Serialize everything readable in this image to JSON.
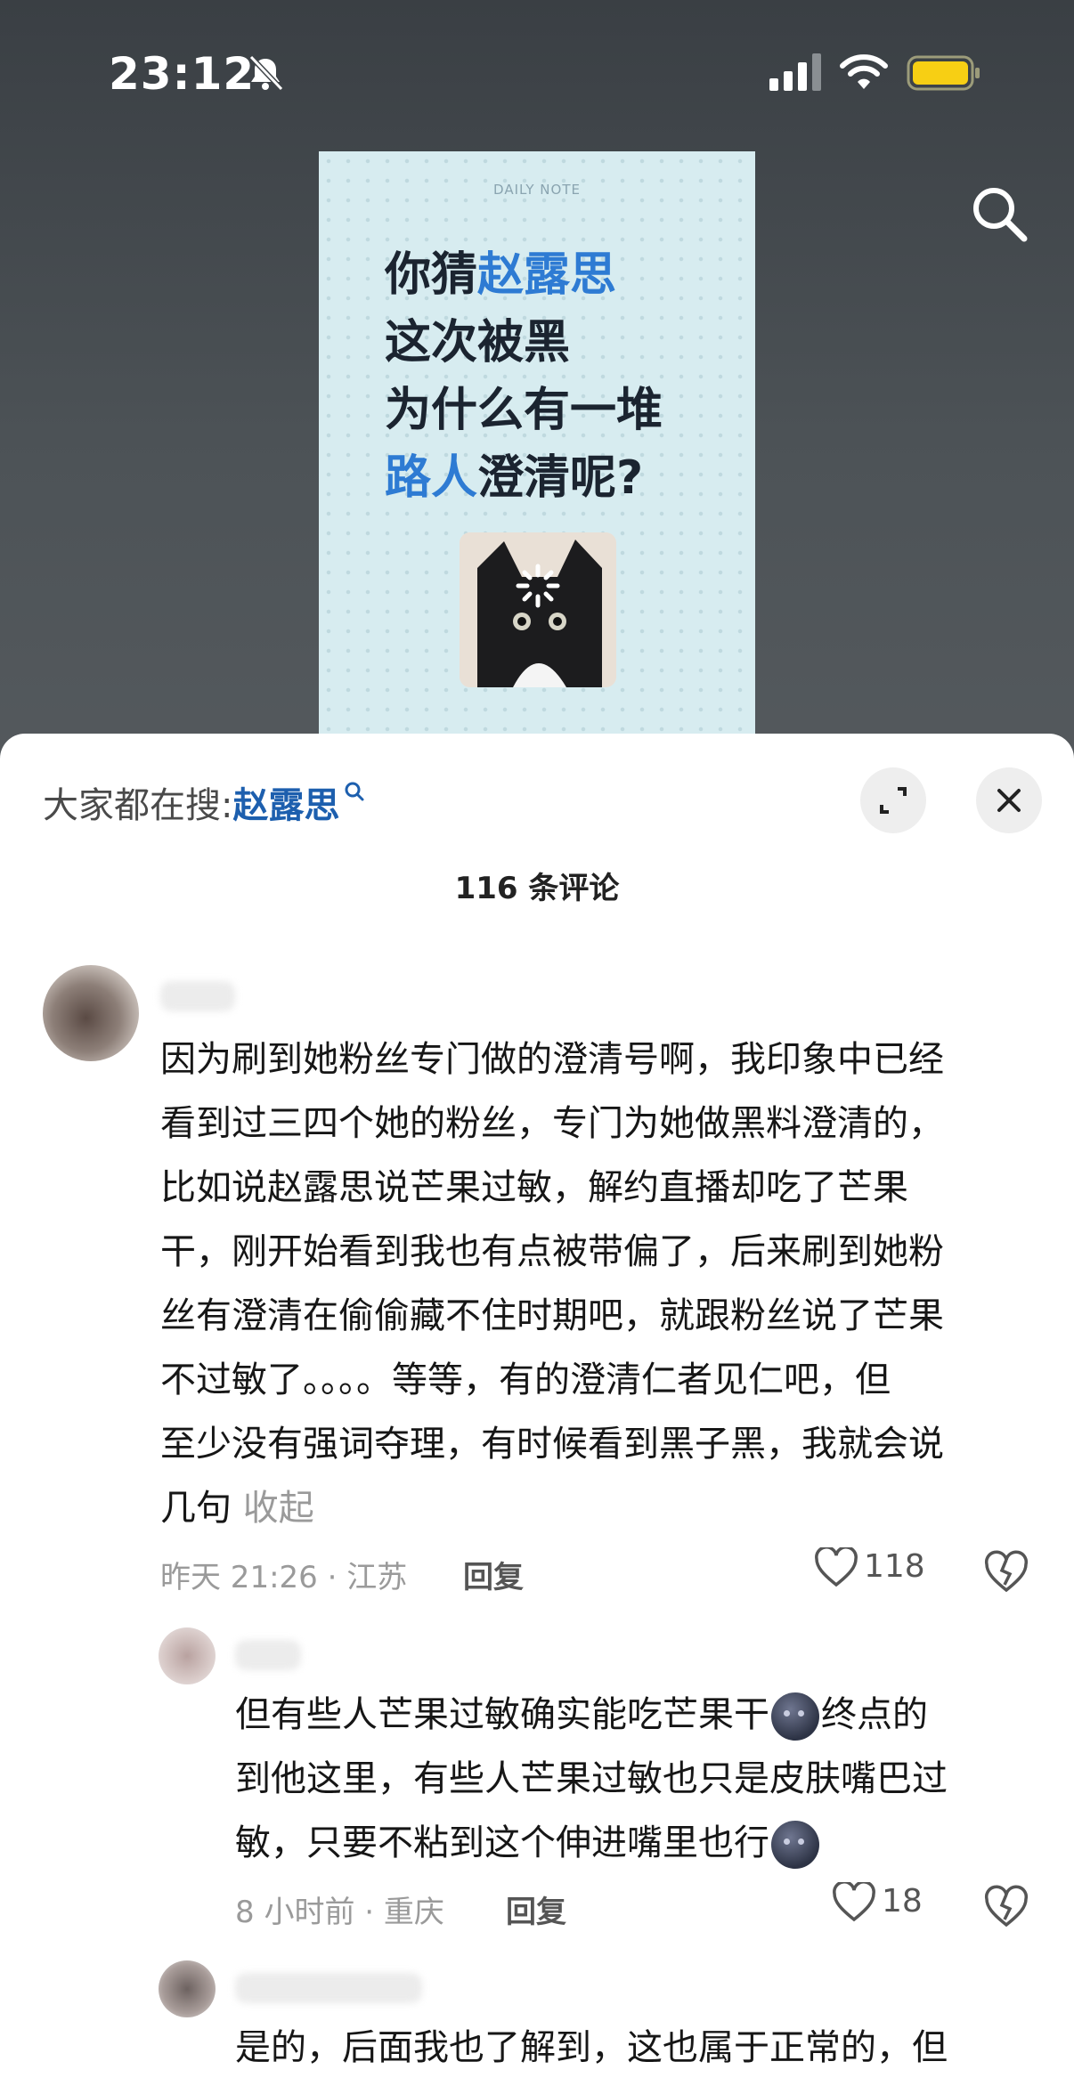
{
  "status_bar": {
    "time": "23:12"
  },
  "post": {
    "card_header": "DAILY NOTE",
    "title_lines": [
      {
        "pre": "你猜",
        "hl": "赵露思",
        "post": ""
      },
      {
        "pre": "这次被黑",
        "hl": "",
        "post": ""
      },
      {
        "pre": "为什么有一堆",
        "hl": "",
        "post": ""
      },
      {
        "pre": "",
        "hl": "路人",
        "post": "澄清呢?"
      }
    ]
  },
  "sheet": {
    "hot_search_label": "大家都在搜:",
    "hot_search_keyword": "赵露思",
    "comment_count": "116 条评论"
  },
  "comments": [
    {
      "lines": [
        "因为刷到她粉丝专门做的澄清号啊，我印象中已经",
        "看到过三四个她的粉丝，专门为她做黑料澄清的，",
        "比如说赵露思说芒果过敏，解约直播却吃了芒果",
        "干，刚开始看到我也有点被带偏了，后来刷到她粉",
        "丝有澄清在偷偷藏不住时期吧，就跟粉丝说了芒果",
        "不过敏了。。。。等等，有的澄清仁者见仁吧，但",
        "至少没有强词夺理，有时候看到黑子黑，我就会说"
      ],
      "last_line": "几句",
      "collapse_label": "收起",
      "meta": "昨天 21:26 · 江苏",
      "reply_label": "回复",
      "likes": "118"
    },
    {
      "line1a": "但有些人芒果过敏确实能吃芒果干",
      "line1b": "终点的",
      "line2": "到他这里，有些人芒果过敏也只是皮肤嘴巴过",
      "line3": "敏，只要不粘到这个伸进嘴里也行",
      "meta": "8 小时前 · 重庆",
      "reply_label": "回复",
      "likes": "18"
    },
    {
      "line1": "是的，后面我也了解到，这也属于正常的，但"
    }
  ],
  "colors": {
    "accent": "#2e7bd3",
    "keyword": "#1d5fae",
    "muted": "#9a9a9a"
  }
}
